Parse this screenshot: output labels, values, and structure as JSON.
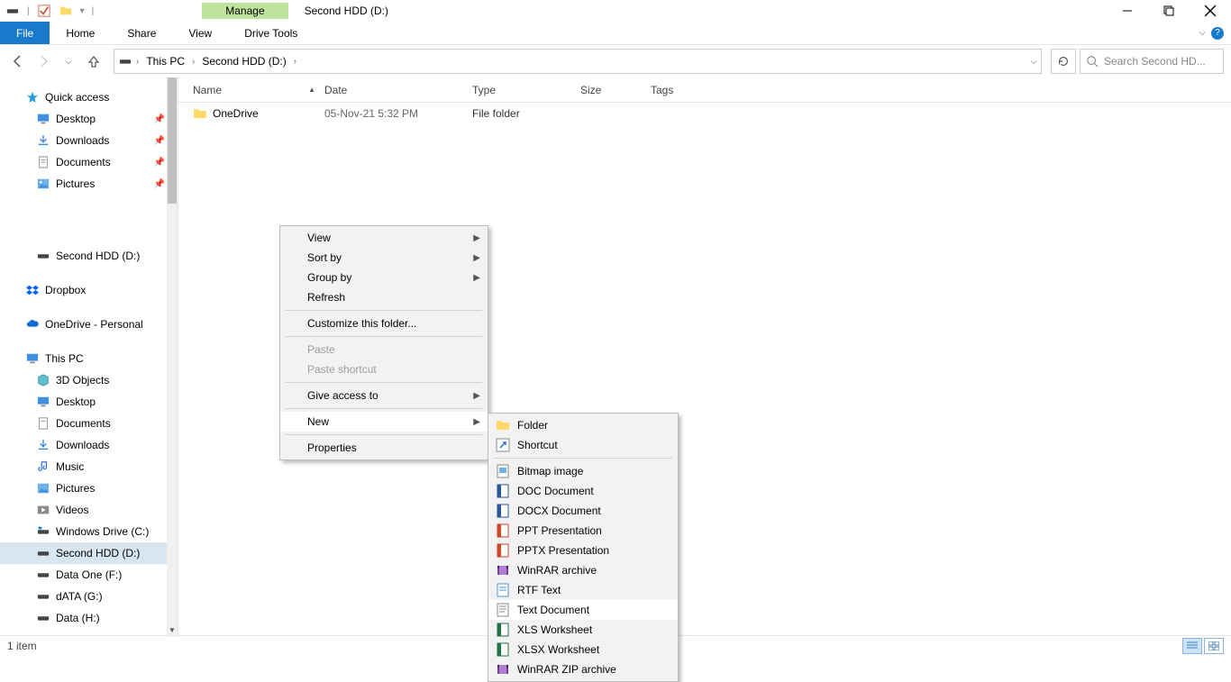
{
  "titlebar": {
    "manage": "Manage",
    "title": "Second HDD (D:)"
  },
  "ribbon": {
    "file": "File",
    "home": "Home",
    "share": "Share",
    "view": "View",
    "drivetools": "Drive Tools"
  },
  "nav": {
    "crumb1": "This PC",
    "crumb2": "Second HDD (D:)",
    "search_placeholder": "Search Second HD..."
  },
  "columns": {
    "name": "Name",
    "date": "Date",
    "type": "Type",
    "size": "Size",
    "tags": "Tags"
  },
  "files": [
    {
      "name": "OneDrive",
      "date": "05-Nov-21 5:32 PM",
      "type": "File folder"
    }
  ],
  "sidebar": {
    "quick_access": "Quick access",
    "desktop": "Desktop",
    "downloads": "Downloads",
    "documents": "Documents",
    "pictures": "Pictures",
    "second_hdd": "Second HDD (D:)",
    "dropbox": "Dropbox",
    "onedrive": "OneDrive - Personal",
    "this_pc": "This PC",
    "objects3d": "3D Objects",
    "desktop2": "Desktop",
    "documents2": "Documents",
    "downloads2": "Downloads",
    "music": "Music",
    "pictures2": "Pictures",
    "videos": "Videos",
    "windows_drive": "Windows Drive (C:)",
    "second_hdd2": "Second HDD (D:)",
    "data_one": "Data One (F:)",
    "data_g": "dATA (G:)",
    "data_h": "Data (H:)"
  },
  "context": {
    "view": "View",
    "sort_by": "Sort by",
    "group_by": "Group by",
    "refresh": "Refresh",
    "customize": "Customize this folder...",
    "paste": "Paste",
    "paste_shortcut": "Paste shortcut",
    "give_access": "Give access to",
    "new": "New",
    "properties": "Properties"
  },
  "submenu": {
    "folder": "Folder",
    "shortcut": "Shortcut",
    "bitmap": "Bitmap image",
    "doc": "DOC Document",
    "docx": "DOCX Document",
    "ppt": "PPT Presentation",
    "pptx": "PPTX Presentation",
    "winrar": "WinRAR archive",
    "rtf": "RTF Text",
    "txt": "Text Document",
    "xls": "XLS Worksheet",
    "xlsx": "XLSX Worksheet",
    "winrar_zip": "WinRAR ZIP archive"
  },
  "status": {
    "count": "1 item"
  }
}
